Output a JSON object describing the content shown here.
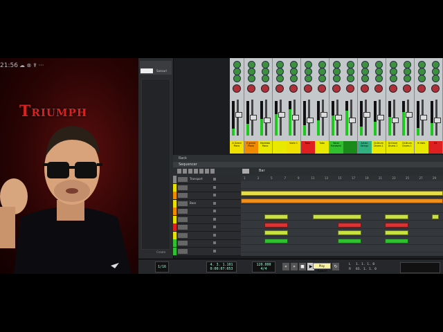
{
  "overlay": {
    "status_time": "21:56",
    "status_icons": "☁ ⊗ ☤ ···",
    "logo_text": "Triumph"
  },
  "browser": {
    "label": "Sansurl",
    "footer": "Create"
  },
  "mixer": {
    "channels": [
      {
        "name": "A Grand Piano",
        "color": "#f0e000"
      },
      {
        "name": "E grand Piano",
        "color": "#f08a00"
      },
      {
        "name": "Marimba Piano",
        "color": "#e8e800"
      },
      {
        "name": "",
        "color": "#e8e800"
      },
      {
        "name": "Violin 1",
        "color": "#f0e000"
      },
      {
        "name": "Bass",
        "color": "#e02020"
      },
      {
        "name": "Tuba",
        "color": "#e8e800"
      },
      {
        "name": "Vocal Yumesmil",
        "color": "#30c030"
      },
      {
        "name": "",
        "color": "#1a8a1a"
      },
      {
        "name": "Action Strings",
        "color": "#30b080"
      },
      {
        "name": "Dr.Drum Drums 1",
        "color": "#e8e800"
      },
      {
        "name": "Dr.Drum Drums 1",
        "color": "#e8e800"
      },
      {
        "name": "Dr.Drum Drums 1",
        "color": "#e8e800"
      },
      {
        "name": "Hi Hats",
        "color": "#e8e800"
      },
      {
        "name": "Kit",
        "color": "#e02020"
      }
    ]
  },
  "rack_tab": "Rack",
  "sequencer_tab": "Sequencer",
  "toolbar": {
    "snap_label": "Bar"
  },
  "tracks": [
    {
      "name": "Transport",
      "color": "#888888"
    },
    {
      "name": "",
      "color": "#e8e000"
    },
    {
      "name": "",
      "color": "#f08a00"
    },
    {
      "name": "Bass",
      "color": "#e8e000"
    },
    {
      "name": "",
      "color": "#f08a00"
    },
    {
      "name": "",
      "color": "#e8e000"
    },
    {
      "name": "",
      "color": "#e02020"
    },
    {
      "name": "",
      "color": "#e8e000"
    },
    {
      "name": "",
      "color": "#30c030"
    },
    {
      "name": "",
      "color": "#30c030"
    }
  ],
  "ruler": [
    "1",
    "3",
    "5",
    "7",
    "9",
    "11",
    "13",
    "15",
    "17",
    "19",
    "21",
    "23",
    "25",
    "27",
    "29"
  ],
  "transport": {
    "quantize": "1/16",
    "position": "4. 3. 1.101",
    "time": "0:00:07:053",
    "tempo": "120.000",
    "signature": "4/4",
    "tooltip": "Play (Space)",
    "loop_left": "1. 1. 1. 0",
    "loop_right": "83. 1. 1. 0",
    "l_label": "L",
    "r_label": "R"
  }
}
